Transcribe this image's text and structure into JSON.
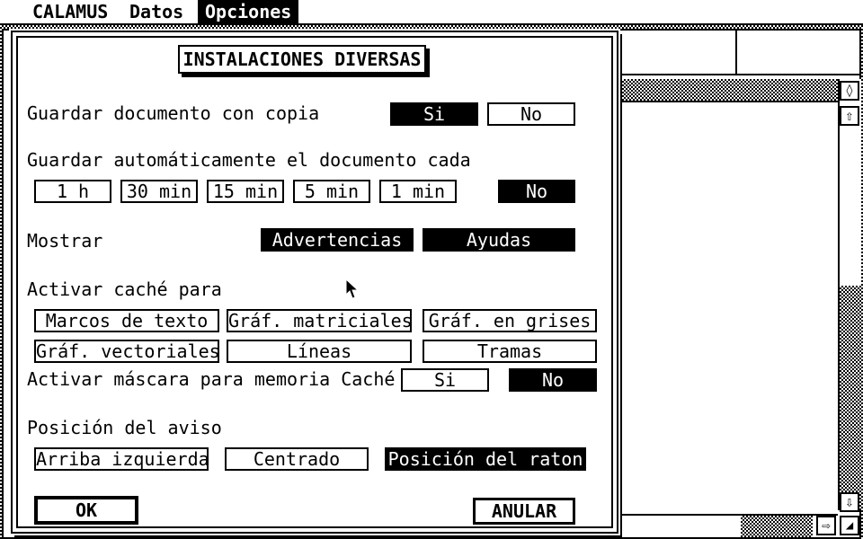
{
  "menubar": {
    "items": [
      {
        "label": "CALAMUS"
      },
      {
        "label": "Datos"
      },
      {
        "label": "Opciones"
      }
    ]
  },
  "dialog": {
    "title": "INSTALACIONES DIVERSAS",
    "save_copy": {
      "label": "Guardar documento con copia",
      "options": [
        "Si",
        "No"
      ],
      "selected": "Si"
    },
    "autosave": {
      "label": "Guardar automáticamente el documento cada",
      "options": [
        "1 h",
        "30 min",
        "15 min",
        "5 min",
        "1 min",
        "No"
      ],
      "selected": "No"
    },
    "show": {
      "label": "Mostrar",
      "options": [
        "Advertencias",
        "Ayudas"
      ],
      "selected": [
        "Advertencias",
        "Ayudas"
      ]
    },
    "cache": {
      "label": "Activar caché para",
      "options": [
        "Marcos de texto",
        "Gráf. matriciales",
        "Gráf. en grises",
        "Gráf. vectoriales",
        "Líneas",
        "Tramas"
      ]
    },
    "cache_mask": {
      "label": "Activar máscara para memoria Caché",
      "options": [
        "Si",
        "No"
      ],
      "selected": "No"
    },
    "alert_position": {
      "label": "Posición del aviso",
      "options": [
        "Arriba izquierda",
        "Centrado",
        "Posición del raton"
      ],
      "selected": "Posición del raton"
    },
    "ok_label": "OK",
    "cancel_label": "ANULAR"
  },
  "icons": {
    "scroll_up": "arrow-up-icon",
    "scroll_down": "arrow-down-icon",
    "scroll_right": "arrow-right-icon",
    "resize": "resize-icon",
    "fuller": "fuller-icon",
    "pointer": "mouse-pointer-icon"
  }
}
